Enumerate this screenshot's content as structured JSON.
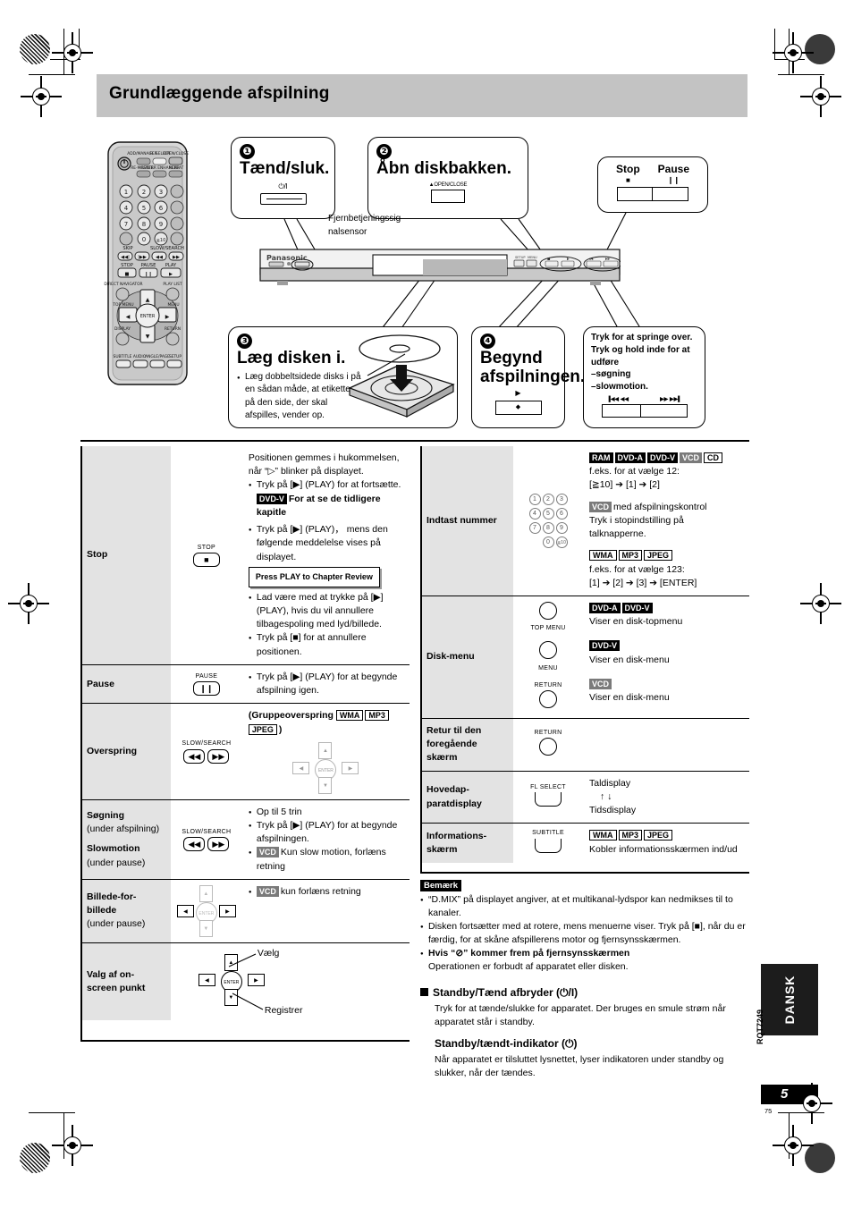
{
  "header": {
    "title": "Grundlæggende afspilning"
  },
  "steps": [
    {
      "num": "❶",
      "title": "Tænd/sluk.",
      "symbol": "⏻/I",
      "key": "power-key"
    },
    {
      "num": "❷",
      "title": "Åbn diskbakken.",
      "symbol": "▲OPEN/CLOSE",
      "key": "open-close-key"
    },
    {
      "num": "❸",
      "title": "Læg disken i.",
      "note": "Læg dobbeltsidede disks i på en sådan måde, at etiketten på den side, der skal afspilles, vender op."
    },
    {
      "num": "❹",
      "title_line1": "Begynd",
      "title_line2": "afspilningen.",
      "symbol": "▶",
      "key": "play-key"
    }
  ],
  "callouts": {
    "sensor": "Fjernbetjeningssig nalsensor",
    "stop_pause": {
      "stop_label": "Stop",
      "pause_label": "Pause",
      "stop_glyph": "■",
      "pause_glyph": "❙❙"
    },
    "skip": {
      "line1": "Tryk for at springe over.",
      "line2": "Tryk og hold inde for at udføre",
      "line3": "–søgning",
      "line4": "–slowmotion.",
      "glyph_left": "▐◀◀  ◀◀",
      "glyph_right": "▶▶  ▶▶▌"
    }
  },
  "device": {
    "brand": "Panasonic"
  },
  "table_left": [
    {
      "label": "Stop",
      "button": {
        "caption": "STOP",
        "glyph": "■",
        "type": "square-key"
      },
      "lines": [
        {
          "kind": "plain",
          "text": "Positionen gemmes i hukommelsen, når “▷” blinker på displayet."
        },
        {
          "kind": "bullet",
          "text": "Tryk på [▶] (PLAY) for at fortsætte."
        },
        {
          "kind": "badge-bold",
          "badges": [
            {
              "text": "DVD-V",
              "style": "black"
            }
          ],
          "text": "For at se de tidligere kapitle"
        },
        {
          "kind": "bullet",
          "text": "Tryk på [▶] (PLAY)， mens den følgende meddelelse vises på displayet."
        },
        {
          "kind": "msgbox",
          "text": "Press PLAY to Chapter Review"
        },
        {
          "kind": "bullet",
          "text": "Lad være med at trykke på [▶] (PLAY), hvis du vil annullere tilbagespoling med lyd/billede."
        },
        {
          "kind": "bullet",
          "text": "Tryk på [■] for at annullere positionen."
        }
      ]
    },
    {
      "label": "Pause",
      "button": {
        "caption": "PAUSE",
        "glyph": "❙❙",
        "type": "square-key"
      },
      "lines": [
        {
          "kind": "bullet",
          "text": "Tryk på [▶] (PLAY) for at begynde afspilning igen."
        }
      ]
    },
    {
      "label": "Overspring",
      "button": {
        "caption": "SLOW/SEARCH",
        "glyph_left": "◀◀",
        "glyph_right": "▶▶",
        "type": "pill-pair"
      },
      "lines": [
        {
          "kind": "group-skip",
          "text": "(Gruppeoverspring",
          "badges": [
            {
              "text": "WMA",
              "style": "outline"
            },
            {
              "text": "MP3",
              "style": "outline"
            },
            {
              "text": "JPEG",
              "style": "outline"
            }
          ],
          "tail": ")"
        },
        {
          "kind": "dpad-light"
        }
      ]
    },
    {
      "label": "Søgning",
      "label_sub": "(under afspilning)",
      "label2": "Slowmotion",
      "label2_sub": "(under pause)",
      "button": {
        "caption": "SLOW/SEARCH",
        "glyph_left": "◀◀",
        "glyph_right": "▶▶",
        "type": "pill-pair"
      },
      "lines": [
        {
          "kind": "bullet",
          "text": "Op til 5 trin"
        },
        {
          "kind": "bullet",
          "text": "Tryk på [▶] (PLAY) for at begynde afspilningen."
        },
        {
          "kind": "bullet-badge",
          "badges": [
            {
              "text": "VCD",
              "style": "gray"
            }
          ],
          "text": "Kun slow motion, forlæns retning"
        }
      ]
    },
    {
      "label": "Billede-for-billede",
      "label_sub": "(under pause)",
      "button": {
        "type": "dpad-dark-lr"
      },
      "lines": [
        {
          "kind": "bullet-badge",
          "badges": [
            {
              "text": "VCD",
              "style": "gray"
            }
          ],
          "text": "kun forlæns retning"
        }
      ]
    },
    {
      "label": "Valg af on-screen punkt",
      "button": {
        "type": "dpad-annotated",
        "annot_top": "Vælg",
        "annot_bottom": "Registrer"
      },
      "lines": []
    }
  ],
  "table_right": [
    {
      "label": "Indtast nummer",
      "button": {
        "type": "keypad",
        "keys": [
          "1",
          "2",
          "3",
          "4",
          "5",
          "6",
          "7",
          "8",
          "9",
          "0",
          "≧10"
        ]
      },
      "lines": [
        {
          "kind": "badge-row",
          "badges": [
            {
              "text": "RAM",
              "style": "black"
            },
            {
              "text": "DVD-A",
              "style": "black"
            },
            {
              "text": "DVD-V",
              "style": "black"
            },
            {
              "text": "VCD",
              "style": "gray"
            },
            {
              "text": "CD",
              "style": "outline"
            }
          ]
        },
        {
          "kind": "plain",
          "text": "f.eks. for at vælge 12:"
        },
        {
          "kind": "plain",
          "text": "[≧10] ➔ [1] ➔ [2]"
        },
        {
          "kind": "spacer"
        },
        {
          "kind": "inline-badge",
          "badges": [
            {
              "text": "VCD",
              "style": "gray"
            }
          ],
          "text": "med afspilningskontrol"
        },
        {
          "kind": "plain",
          "text": "Tryk i stopindstilling på talknapperne."
        },
        {
          "kind": "spacer"
        },
        {
          "kind": "badge-row",
          "badges": [
            {
              "text": "WMA",
              "style": "outline"
            },
            {
              "text": "MP3",
              "style": "outline"
            },
            {
              "text": "JPEG",
              "style": "outline"
            }
          ]
        },
        {
          "kind": "plain",
          "text": "f.eks. for at vælge 123:"
        },
        {
          "kind": "plain",
          "text": "[1] ➔ [2] ➔ [3] ➔ [ENTER]"
        }
      ]
    },
    {
      "label": "Disk-menu",
      "button": {
        "type": "three-circles",
        "items": [
          {
            "caption": "TOP MENU",
            "caption_pos": "below"
          },
          {
            "caption": "MENU",
            "caption_pos": "below"
          },
          {
            "caption": "RETURN",
            "caption_pos": "above"
          }
        ]
      },
      "lines": [
        {
          "kind": "badge-row",
          "badges": [
            {
              "text": "DVD-A",
              "style": "black"
            },
            {
              "text": "DVD-V",
              "style": "black"
            }
          ]
        },
        {
          "kind": "plain",
          "text": "Viser en disk-topmenu"
        },
        {
          "kind": "spacer"
        },
        {
          "kind": "badge-row",
          "badges": [
            {
              "text": "DVD-V",
              "style": "black"
            }
          ]
        },
        {
          "kind": "plain",
          "text": "Viser en disk-menu"
        },
        {
          "kind": "spacer"
        },
        {
          "kind": "badge-row",
          "badges": [
            {
              "text": "VCD",
              "style": "gray"
            }
          ]
        },
        {
          "kind": "plain",
          "text": "Viser en disk-menu"
        }
      ]
    },
    {
      "label": "Retur til den foregående skærm",
      "button": {
        "type": "circle",
        "caption": "RETURN"
      },
      "lines": []
    },
    {
      "label": "Hovedap-paratdisplay",
      "button": {
        "type": "pill",
        "caption": "FL SELECT"
      },
      "lines": [
        {
          "kind": "plain",
          "text": "Taldisplay"
        },
        {
          "kind": "plain",
          "text": "↑ ↓"
        },
        {
          "kind": "plain",
          "text": "Tidsdisplay"
        }
      ]
    },
    {
      "label": "Informations-skærm",
      "button": {
        "type": "pill",
        "caption": "SUBTITLE"
      },
      "lines": [
        {
          "kind": "badge-row",
          "badges": [
            {
              "text": "WMA",
              "style": "outline"
            },
            {
              "text": "MP3",
              "style": "outline"
            },
            {
              "text": "JPEG",
              "style": "outline"
            }
          ]
        },
        {
          "kind": "plain",
          "text": "Kobler informationsskærmen ind/ud"
        }
      ]
    }
  ],
  "notes": {
    "heading": "Bemærk",
    "items": [
      "“D.MIX” på displayet angiver, at et multikanal-lydspor kan nedmikses til to kanaler.",
      "Disken fortsætter med at rotere, mens menuerne viser. Tryk på [■], når du er færdig, for at skåne afspillerens motor og fjernsynsskærmen."
    ],
    "bold_item": "Hvis “⊘” kommer frem på fjernsynsskærmen",
    "bold_item_body": "Operationen er forbudt af apparatet eller disken.",
    "sections": [
      {
        "heading": "Standby/Tænd afbryder (⏻/I)",
        "body": "Tryk for at tænde/slukke for apparatet. Der bruges en smule strøm når apparatet står i standby."
      },
      {
        "heading": "Standby/tændt-indikator (⏻)",
        "body": "Når apparatet er tilsluttet lysnettet, lyser indikatoren under standby og slukker, når der tændes."
      }
    ]
  },
  "footer": {
    "language_tab": "DANSK",
    "doc_code": "RQT7249",
    "page_number": "5",
    "folio": "75"
  }
}
